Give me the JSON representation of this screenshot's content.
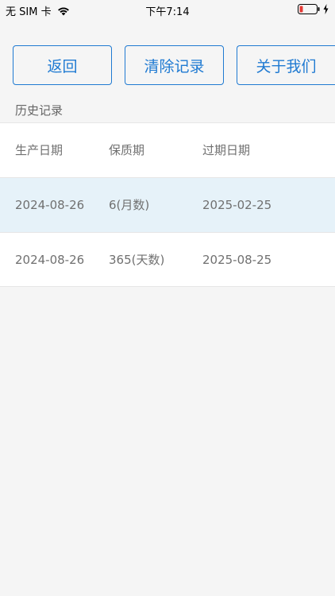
{
  "status_bar": {
    "carrier": "无 SIM 卡",
    "time": "下午7:14",
    "icons": [
      "wifi-icon",
      "battery-low-icon",
      "charging-bolt-icon"
    ],
    "battery_color": "#e53935"
  },
  "toolbar": {
    "back_label": "返回",
    "clear_label": "清除记录",
    "about_label": "关于我们",
    "accent_color": "#1f7ad2"
  },
  "history": {
    "section_label": "历史记录",
    "columns": [
      "生产日期",
      "保质期",
      "过期日期"
    ],
    "rows": [
      [
        "2024-08-26",
        "6(月数)",
        "2025-02-25"
      ],
      [
        "2024-08-26",
        "365(天数)",
        "2025-08-25"
      ]
    ],
    "highlight_color": "#e6f2f9"
  }
}
